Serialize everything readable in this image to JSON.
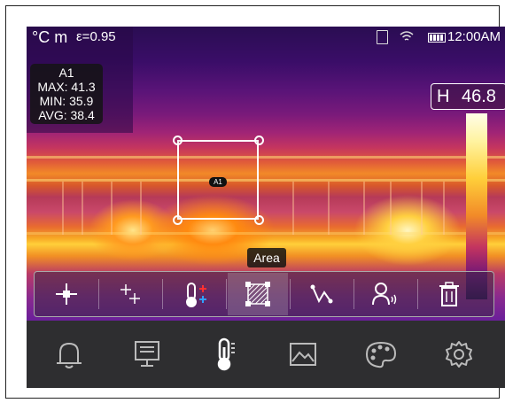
{
  "status_bar": {
    "unit": "°C m",
    "emissivity": "ε=0.95",
    "time": "12:00AM"
  },
  "measurement": {
    "name": "A1",
    "max": "MAX: 41.3",
    "min": "MIN: 35.9",
    "avg": "AVG: 38.4"
  },
  "readout": {
    "label": "H",
    "value": "46.8"
  },
  "area_tag": "A1",
  "tooltip": "Area",
  "tools": [
    {
      "icon": "center-point-icon"
    },
    {
      "icon": "hot-cold-point-icon"
    },
    {
      "icon": "thermometer-points-icon"
    },
    {
      "icon": "area-icon",
      "selected": true
    },
    {
      "icon": "line-icon"
    },
    {
      "icon": "voice-icon"
    },
    {
      "icon": "trash-icon"
    }
  ],
  "nav": [
    {
      "icon": "bell-icon"
    },
    {
      "icon": "display-icon"
    },
    {
      "icon": "thermometer-icon",
      "selected": true
    },
    {
      "icon": "image-icon"
    },
    {
      "icon": "palette-icon"
    },
    {
      "icon": "gear-icon"
    }
  ],
  "colors": {
    "accent": "#ffffff",
    "nav_bg": "#2e2e30"
  }
}
